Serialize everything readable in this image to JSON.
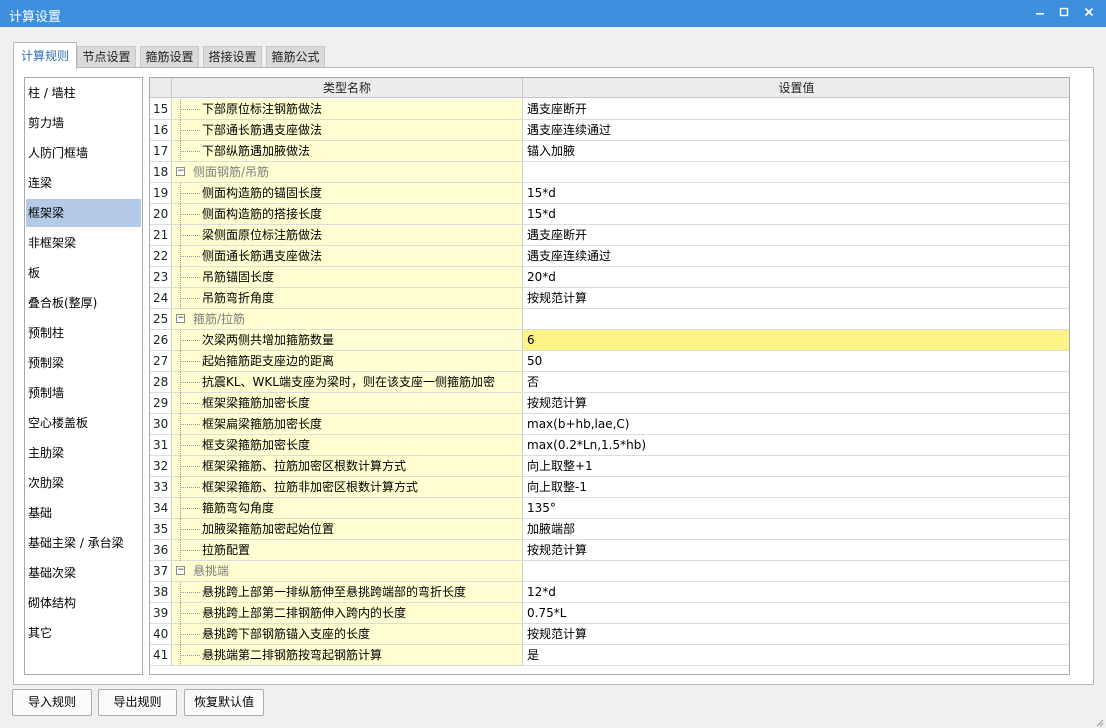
{
  "window": {
    "title": "计算设置",
    "minimize_icon": "minimize-icon",
    "maximize_icon": "maximize-icon",
    "close_icon": "close-icon"
  },
  "tabs": [
    {
      "label": "计算规则",
      "active": true
    },
    {
      "label": "节点设置",
      "active": false
    },
    {
      "label": "箍筋设置",
      "active": false
    },
    {
      "label": "搭接设置",
      "active": false
    },
    {
      "label": "箍筋公式",
      "active": false
    }
  ],
  "sidebar": {
    "items": [
      {
        "label": "柱 / 墙柱"
      },
      {
        "label": "剪力墙"
      },
      {
        "label": "人防门框墙"
      },
      {
        "label": "连梁"
      },
      {
        "label": "框架梁",
        "selected": true
      },
      {
        "label": "非框架梁"
      },
      {
        "label": "板"
      },
      {
        "label": "叠合板(整厚)"
      },
      {
        "label": "预制柱"
      },
      {
        "label": "预制梁"
      },
      {
        "label": "预制墙"
      },
      {
        "label": "空心楼盖板"
      },
      {
        "label": "主肋梁"
      },
      {
        "label": "次肋梁"
      },
      {
        "label": "基础"
      },
      {
        "label": "基础主梁 / 承台梁"
      },
      {
        "label": "基础次梁"
      },
      {
        "label": "砌体结构"
      },
      {
        "label": "其它"
      }
    ]
  },
  "grid": {
    "headers": {
      "type": "类型名称",
      "value": "设置值"
    },
    "rows": [
      {
        "num": "15",
        "name": "下部原位标注钢筋做法",
        "value": "遇支座断开"
      },
      {
        "num": "16",
        "name": "下部通长筋遇支座做法",
        "value": "遇支座连续通过"
      },
      {
        "num": "17",
        "name": "下部纵筋遇加腋做法",
        "value": "锚入加腋"
      },
      {
        "num": "18",
        "name": "侧面钢筋/吊筋",
        "value": "",
        "group": true
      },
      {
        "num": "19",
        "name": "侧面构造筋的锚固长度",
        "value": "15*d"
      },
      {
        "num": "20",
        "name": "侧面构造筋的搭接长度",
        "value": "15*d"
      },
      {
        "num": "21",
        "name": "梁侧面原位标注筋做法",
        "value": "遇支座断开"
      },
      {
        "num": "22",
        "name": "侧面通长筋遇支座做法",
        "value": "遇支座连续通过"
      },
      {
        "num": "23",
        "name": "吊筋锚固长度",
        "value": "20*d"
      },
      {
        "num": "24",
        "name": "吊筋弯折角度",
        "value": "按规范计算"
      },
      {
        "num": "25",
        "name": "箍筋/拉筋",
        "value": "",
        "group": true
      },
      {
        "num": "26",
        "name": "次梁两侧共增加箍筋数量",
        "value": "6",
        "highlight": true
      },
      {
        "num": "27",
        "name": "起始箍筋距支座边的距离",
        "value": "50"
      },
      {
        "num": "28",
        "name": "抗震KL、WKL端支座为梁时，则在该支座一侧箍筋加密",
        "value": "否"
      },
      {
        "num": "29",
        "name": "框架梁箍筋加密长度",
        "value": "按规范计算"
      },
      {
        "num": "30",
        "name": "框架扁梁箍筋加密长度",
        "value": "max(b+hb,lae,C)"
      },
      {
        "num": "31",
        "name": "框支梁箍筋加密长度",
        "value": "max(0.2*Ln,1.5*hb)"
      },
      {
        "num": "32",
        "name": "框架梁箍筋、拉筋加密区根数计算方式",
        "value": "向上取整+1"
      },
      {
        "num": "33",
        "name": "框架梁箍筋、拉筋非加密区根数计算方式",
        "value": "向上取整-1"
      },
      {
        "num": "34",
        "name": "箍筋弯勾角度",
        "value": "135°"
      },
      {
        "num": "35",
        "name": "加腋梁箍筋加密起始位置",
        "value": "加腋端部"
      },
      {
        "num": "36",
        "name": "拉筋配置",
        "value": "按规范计算"
      },
      {
        "num": "37",
        "name": "悬挑端",
        "value": "",
        "group": true
      },
      {
        "num": "38",
        "name": "悬挑跨上部第一排纵筋伸至悬挑跨端部的弯折长度",
        "value": "12*d"
      },
      {
        "num": "39",
        "name": "悬挑跨上部第二排钢筋伸入跨内的长度",
        "value": "0.75*L"
      },
      {
        "num": "40",
        "name": "悬挑跨下部钢筋锚入支座的长度",
        "value": "按规范计算"
      },
      {
        "num": "41",
        "name": "悬挑端第二排钢筋按弯起钢筋计算",
        "value": "是"
      }
    ]
  },
  "footer": {
    "import_label": "导入规则",
    "export_label": "导出规则",
    "restore_label": "恢复默认值"
  },
  "colors": {
    "titlebar": "#3e8ede",
    "name_cell": "#ffffd2",
    "highlight": "#fff487",
    "selected": "#b4cbe8",
    "active_tab_text": "#2f6fb6"
  }
}
